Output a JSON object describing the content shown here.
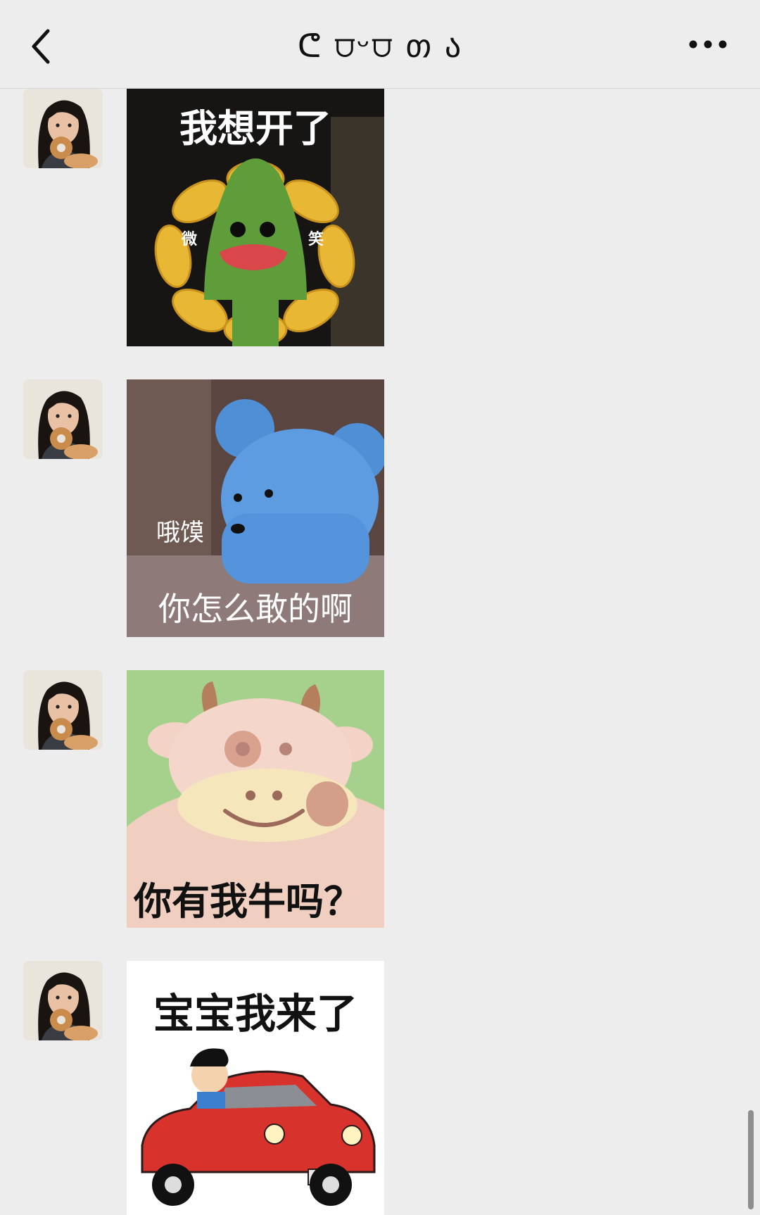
{
  "header": {
    "title": "ᕦ ⩌ᵕ⩌ თ ა",
    "back_icon": "chevron-left-icon",
    "more_icon": "more-dots-icon"
  },
  "messages": [
    {
      "sender": "contact",
      "sticker": {
        "top_text": "我想开了",
        "side_left": "微",
        "side_right": "笑"
      }
    },
    {
      "sender": "contact",
      "sticker": {
        "small_text": "哦馍",
        "bottom_text": "你怎么敢的啊"
      }
    },
    {
      "sender": "contact",
      "sticker": {
        "bottom_text": "你有我牛吗？"
      }
    },
    {
      "sender": "contact",
      "sticker": {
        "top_text": "宝宝我来了"
      }
    }
  ],
  "colors": {
    "background": "#ededed",
    "header": "#ededed"
  }
}
